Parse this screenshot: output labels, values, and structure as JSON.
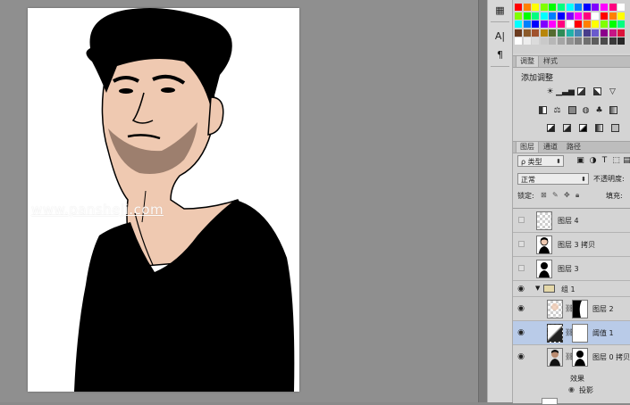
{
  "watermark": "www.pansheji.com",
  "tool_strip": {
    "icons": [
      "palette-icon",
      "character-icon",
      "paragraph-icon"
    ],
    "glyphs": [
      "▦",
      "A|",
      "¶"
    ]
  },
  "adjust_panel": {
    "tabs": [
      "调整",
      "样式"
    ],
    "title": "添加调整"
  },
  "layers_panel": {
    "tabs": [
      "图层",
      "通道",
      "路径"
    ],
    "filter_kind": "ρ 类型",
    "blend_mode": "正常",
    "opacity_label": "不透明度:",
    "lock_label": "锁定:",
    "fill_label": "填充:",
    "layers": [
      {
        "name": "图层 4",
        "visible": false,
        "kind": "checker"
      },
      {
        "name": "图层 3 拷贝",
        "visible": false,
        "kind": "portrait"
      },
      {
        "name": "图层 3",
        "visible": false,
        "kind": "silhouette"
      },
      {
        "name": "组 1",
        "visible": true,
        "kind": "group"
      },
      {
        "name": "图层 2",
        "visible": true,
        "kind": "masked"
      },
      {
        "name": "阈值 1",
        "visible": true,
        "kind": "adjustment",
        "selected": true
      },
      {
        "name": "图层 0 拷贝",
        "visible": true,
        "kind": "portrait-masked"
      }
    ],
    "effects_label": "效果",
    "drop_shadow_label": "投影"
  },
  "colors": {
    "skin": "#efc9b1",
    "ink": "#000000",
    "selected_row": "#b9cbe8"
  }
}
